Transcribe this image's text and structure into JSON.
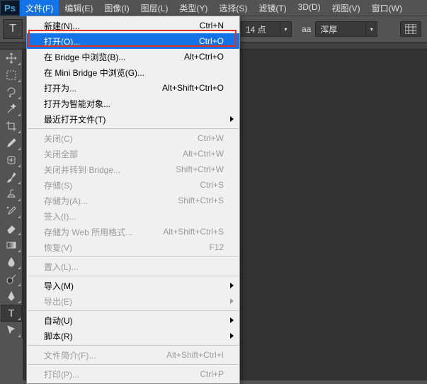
{
  "app_logo": "Ps",
  "menubar": {
    "items": [
      "文件(F)",
      "编辑(E)",
      "图像(I)",
      "图层(L)",
      "类型(Y)",
      "选择(S)",
      "滤镜(T)",
      "3D(D)",
      "视图(V)",
      "窗口(W)"
    ],
    "active_index": 0
  },
  "optionsbar": {
    "tool_glyph": "T",
    "font_size_value": "14 点",
    "aa_glyph": "aa",
    "aa_value": "浑厚"
  },
  "dropdown": {
    "groups": [
      [
        {
          "label": "新建(N)...",
          "shortcut": "Ctrl+N",
          "disabled": false,
          "sub": false
        },
        {
          "label": "打开(O)...",
          "shortcut": "Ctrl+O",
          "disabled": false,
          "sub": false,
          "highlight": true
        },
        {
          "label": "在 Bridge 中浏览(B)...",
          "shortcut": "Alt+Ctrl+O",
          "disabled": false,
          "sub": false
        },
        {
          "label": "在 Mini Bridge 中浏览(G)...",
          "shortcut": "",
          "disabled": false,
          "sub": false
        },
        {
          "label": "打开为...",
          "shortcut": "Alt+Shift+Ctrl+O",
          "disabled": false,
          "sub": false
        },
        {
          "label": "打开为智能对象...",
          "shortcut": "",
          "disabled": false,
          "sub": false
        },
        {
          "label": "最近打开文件(T)",
          "shortcut": "",
          "disabled": false,
          "sub": true
        }
      ],
      [
        {
          "label": "关闭(C)",
          "shortcut": "Ctrl+W",
          "disabled": true,
          "sub": false
        },
        {
          "label": "关闭全部",
          "shortcut": "Alt+Ctrl+W",
          "disabled": true,
          "sub": false
        },
        {
          "label": "关闭并转到 Bridge...",
          "shortcut": "Shift+Ctrl+W",
          "disabled": true,
          "sub": false
        },
        {
          "label": "存储(S)",
          "shortcut": "Ctrl+S",
          "disabled": true,
          "sub": false
        },
        {
          "label": "存储为(A)...",
          "shortcut": "Shift+Ctrl+S",
          "disabled": true,
          "sub": false
        },
        {
          "label": "签入(I)...",
          "shortcut": "",
          "disabled": true,
          "sub": false
        },
        {
          "label": "存储为 Web 所用格式...",
          "shortcut": "Alt+Shift+Ctrl+S",
          "disabled": true,
          "sub": false
        },
        {
          "label": "恢复(V)",
          "shortcut": "F12",
          "disabled": true,
          "sub": false
        }
      ],
      [
        {
          "label": "置入(L)...",
          "shortcut": "",
          "disabled": true,
          "sub": false
        }
      ],
      [
        {
          "label": "导入(M)",
          "shortcut": "",
          "disabled": false,
          "sub": true
        },
        {
          "label": "导出(E)",
          "shortcut": "",
          "disabled": true,
          "sub": true
        }
      ],
      [
        {
          "label": "自动(U)",
          "shortcut": "",
          "disabled": false,
          "sub": true
        },
        {
          "label": "脚本(R)",
          "shortcut": "",
          "disabled": false,
          "sub": true
        }
      ],
      [
        {
          "label": "文件简介(F)...",
          "shortcut": "Alt+Shift+Ctrl+I",
          "disabled": true,
          "sub": false
        }
      ],
      [
        {
          "label": "打印(P)...",
          "shortcut": "Ctrl+P",
          "disabled": true,
          "sub": false
        }
      ]
    ]
  },
  "tools": [
    {
      "name": "move-tool"
    },
    {
      "name": "rect-marquee-tool"
    },
    {
      "name": "lasso-tool"
    },
    {
      "name": "magic-wand-tool"
    },
    {
      "name": "crop-tool"
    },
    {
      "name": "eyedropper-tool"
    },
    {
      "name": "healing-brush-tool"
    },
    {
      "name": "brush-tool"
    },
    {
      "name": "clone-stamp-tool"
    },
    {
      "name": "history-brush-tool"
    },
    {
      "name": "eraser-tool"
    },
    {
      "name": "gradient-tool"
    },
    {
      "name": "blur-tool"
    },
    {
      "name": "dodge-tool"
    },
    {
      "name": "pen-tool"
    },
    {
      "name": "type-tool",
      "selected": true
    },
    {
      "name": "path-selection-tool"
    }
  ]
}
